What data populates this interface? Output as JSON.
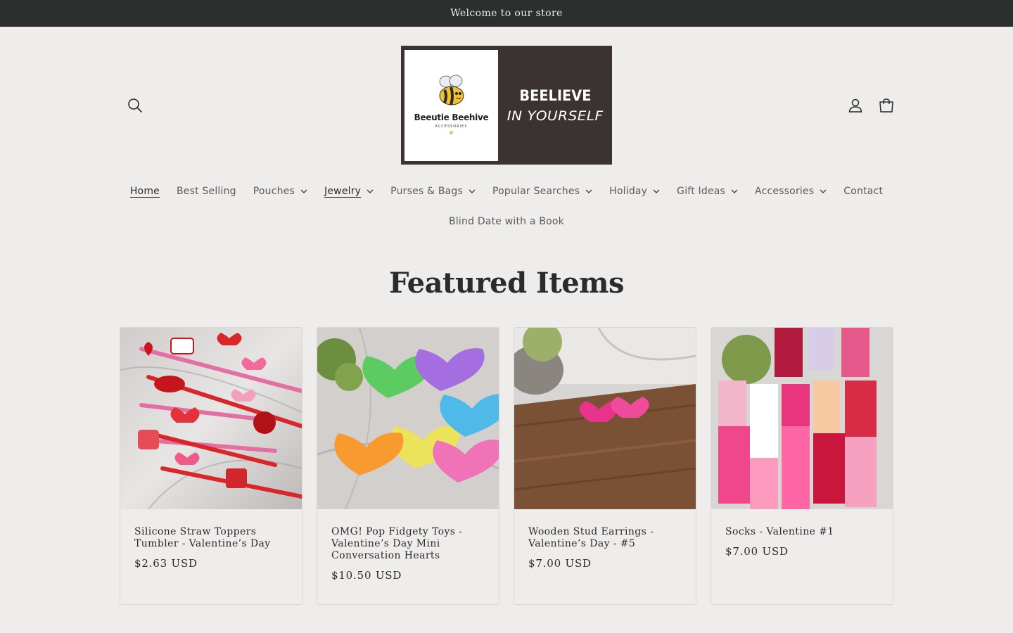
{
  "announcement": "Welcome to our store",
  "logo": {
    "brand": "Beeutie Beehive",
    "sub": "ACCESSORIES",
    "line1": "BEELIEVE",
    "line2": "IN YOURSELF"
  },
  "nav": {
    "row1": [
      {
        "label": "Home",
        "dropdown": false
      },
      {
        "label": "Best Selling",
        "dropdown": false
      },
      {
        "label": "Pouches",
        "dropdown": true
      },
      {
        "label": "Jewelry",
        "dropdown": true
      },
      {
        "label": "Purses & Bags",
        "dropdown": true
      },
      {
        "label": "Popular Searches",
        "dropdown": true
      },
      {
        "label": "Holiday",
        "dropdown": true
      },
      {
        "label": "Gift Ideas",
        "dropdown": true
      },
      {
        "label": "Accessories",
        "dropdown": true
      },
      {
        "label": "Contact",
        "dropdown": false
      }
    ],
    "row2": "Blind Date with a Book"
  },
  "section": {
    "title": "Featured Items"
  },
  "products": [
    {
      "title": "Silicone Straw Toppers Tumbler - Valentine’s Day",
      "price": "$2.63 USD"
    },
    {
      "title": "OMG! Pop Fidgety Toys - Valentine’s Day Mini Conversation Hearts",
      "price": "$10.50 USD"
    },
    {
      "title": "Wooden Stud Earrings - Valentine’s Day - #5",
      "price": "$7.00 USD"
    },
    {
      "title": "Socks - Valentine #1",
      "price": "$7.00 USD"
    }
  ],
  "colors": {
    "announcement_bg": "#2b302e",
    "page_bg": "#efedec",
    "logo_bg": "#3a3332"
  },
  "icons": [
    "search-icon",
    "account-icon",
    "cart-icon",
    "chevron-down-icon"
  ]
}
